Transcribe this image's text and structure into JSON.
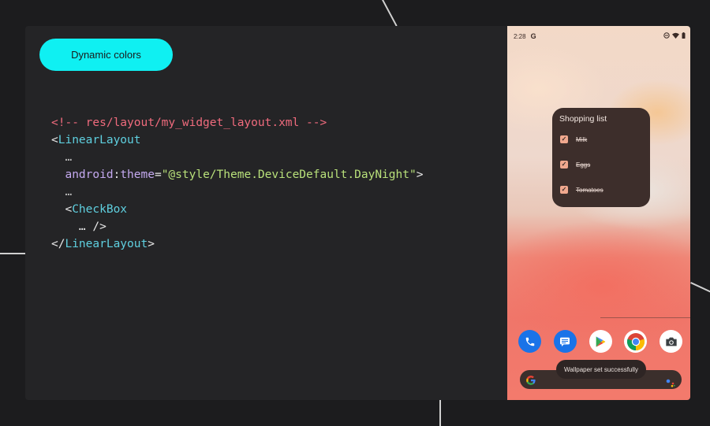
{
  "slide": {
    "pill_label": "Dynamic colors",
    "code": {
      "line1": "<!-- res/layout/my_widget_layout.xml -->",
      "line2_open": "<",
      "line2_tag": "LinearLayout",
      "line3": "…",
      "line4_ns": "android",
      "line4_colon": ":",
      "line4_attr": "theme",
      "line4_eq": "=",
      "line4_value": "\"@style/Theme.DeviceDefault.DayNight\"",
      "line4_close": ">",
      "line5": "…",
      "line6_open": "<",
      "line6_tag": "CheckBox",
      "line7": "… />",
      "line8_open": "</",
      "line8_tag": "LinearLayout",
      "line8_close": ">"
    }
  },
  "phone": {
    "status": {
      "time": "2:28",
      "g_letter": "G"
    },
    "widget": {
      "title": "Shopping list",
      "items": [
        {
          "label": "Milk",
          "checked": true
        },
        {
          "label": "Eggs",
          "checked": true
        },
        {
          "label": "Tomatoes",
          "checked": true
        }
      ],
      "check_glyph": "✓"
    },
    "dock_icons": [
      "phone-icon",
      "messages-icon",
      "play-store-icon",
      "chrome-icon",
      "camera-icon"
    ],
    "toast": "Wallpaper set successfully",
    "colors": {
      "pill": "#0ff0f2",
      "widget_bg": "#3d2e2b",
      "checkbox": "#f0a88e",
      "comment": "#f06b7d",
      "tag": "#5fd0e0",
      "attr": "#c4a9f0",
      "string": "#b8e07a"
    }
  }
}
